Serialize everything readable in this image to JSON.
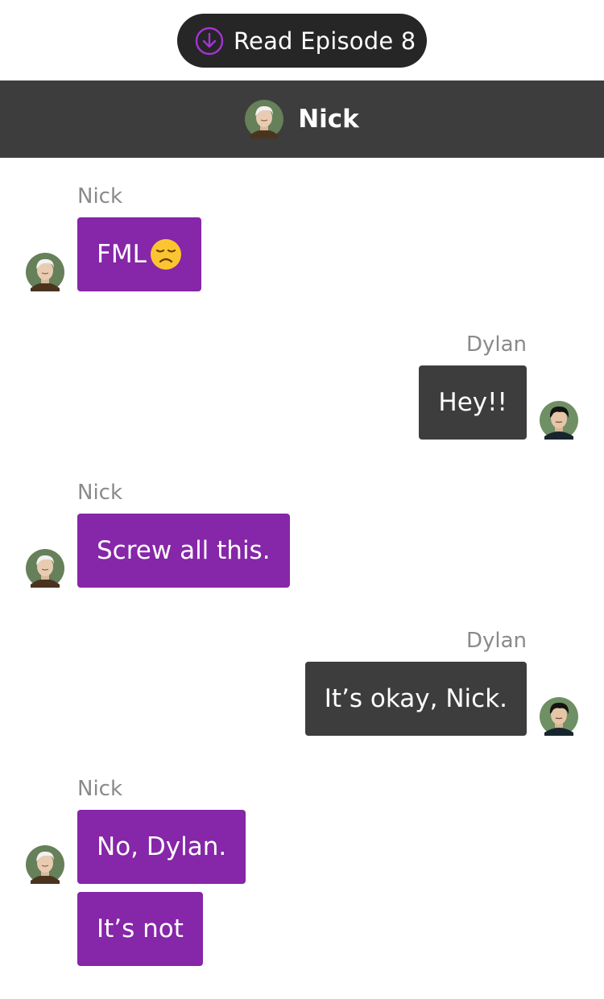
{
  "read_button": {
    "label": "Read Episode 8",
    "icon": "download-circle-icon",
    "accent": "#a633d6"
  },
  "header": {
    "title": "Nick",
    "avatar": "nick-avatar"
  },
  "colors": {
    "nick_bubble": "#8626a8",
    "dylan_bubble": "#3d3d3d",
    "header_bg": "#3d3d3d",
    "sender_label": "#8a8a8a"
  },
  "messages": [
    {
      "sender": "Nick",
      "text": "FML",
      "emoji": "disappointed-face-emoji"
    },
    {
      "sender": "Dylan",
      "text": "Hey!!"
    },
    {
      "sender": "Nick",
      "text": "Screw all this."
    },
    {
      "sender": "Dylan",
      "text": "It’s okay, Nick."
    },
    {
      "sender": "Nick",
      "text": "No, Dylan."
    },
    {
      "sender": "Nick",
      "text": "It’s not"
    }
  ]
}
